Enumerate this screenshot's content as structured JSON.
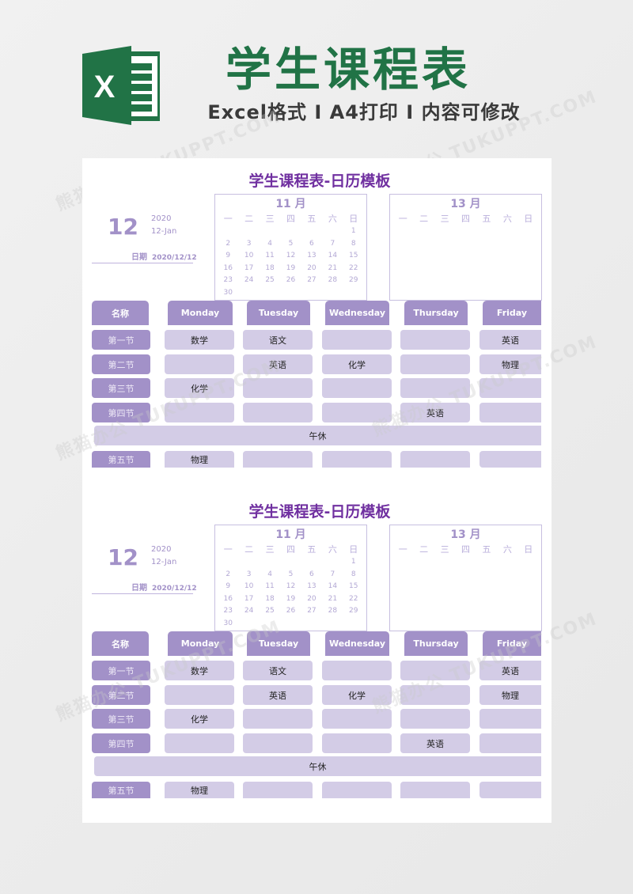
{
  "banner": {
    "logo_icon": "excel-logo-icon",
    "logo_letter": "X",
    "title": "学生课程表",
    "subtitle": "Excel格式 I A4打印 I 内容可修改",
    "watermark": "熊猫办公 TUKUPPT.COM",
    "brand_color": "#217346"
  },
  "colors": {
    "title_purple": "#7030a0",
    "header_purple": "#a291c8",
    "cell_lilac": "#d3cce6"
  },
  "sheets": [
    {
      "title": "学生课程表-日历模板",
      "date_block": {
        "day": "12",
        "year": "2020",
        "day_month": "12-Jan",
        "date_label": "日期",
        "date_value": "2020/12/12"
      },
      "calendars": [
        {
          "title": "11 月",
          "weekdays": [
            "一",
            "二",
            "三",
            "四",
            "五",
            "六",
            "日"
          ],
          "weeks": [
            [
              "",
              "",
              "",
              "",
              "",
              "",
              "1"
            ],
            [
              "2",
              "3",
              "4",
              "5",
              "6",
              "7",
              "8"
            ],
            [
              "9",
              "10",
              "11",
              "12",
              "13",
              "14",
              "15"
            ],
            [
              "16",
              "17",
              "18",
              "19",
              "20",
              "21",
              "22"
            ],
            [
              "23",
              "24",
              "25",
              "26",
              "27",
              "28",
              "29"
            ],
            [
              "30",
              "",
              "",
              "",
              "",
              "",
              ""
            ]
          ]
        },
        {
          "title": "13 月",
          "weekdays": [
            "一",
            "二",
            "三",
            "四",
            "五",
            "六",
            "日"
          ],
          "weeks": []
        }
      ],
      "schedule": {
        "corner_label": "名称",
        "days": [
          "Monday",
          "Tuesday",
          "Wednesday",
          "Thursday",
          "Friday"
        ],
        "periods": [
          {
            "label": "第一节",
            "classes": [
              "数学",
              "语文",
              "",
              "",
              "英语"
            ]
          },
          {
            "label": "第二节",
            "classes": [
              "",
              "英语",
              "化学",
              "",
              "物理"
            ]
          },
          {
            "label": "第三节",
            "classes": [
              "化学",
              "",
              "",
              "",
              ""
            ]
          },
          {
            "label": "第四节",
            "classes": [
              "",
              "",
              "",
              "英语",
              ""
            ]
          },
          {
            "label": "第五节",
            "classes": [
              "物理",
              "",
              "",
              "",
              ""
            ]
          }
        ],
        "lunch_label": "午休"
      }
    },
    {
      "title": "学生课程表-日历模板",
      "date_block": {
        "day": "12",
        "year": "2020",
        "day_month": "12-Jan",
        "date_label": "日期",
        "date_value": "2020/12/12"
      },
      "calendars": [
        {
          "title": "11 月",
          "weekdays": [
            "一",
            "二",
            "三",
            "四",
            "五",
            "六",
            "日"
          ],
          "weeks": [
            [
              "",
              "",
              "",
              "",
              "",
              "",
              "1"
            ],
            [
              "2",
              "3",
              "4",
              "5",
              "6",
              "7",
              "8"
            ],
            [
              "9",
              "10",
              "11",
              "12",
              "13",
              "14",
              "15"
            ],
            [
              "16",
              "17",
              "18",
              "19",
              "20",
              "21",
              "22"
            ],
            [
              "23",
              "24",
              "25",
              "26",
              "27",
              "28",
              "29"
            ],
            [
              "30",
              "",
              "",
              "",
              "",
              "",
              ""
            ]
          ]
        },
        {
          "title": "13 月",
          "weekdays": [
            "一",
            "二",
            "三",
            "四",
            "五",
            "六",
            "日"
          ],
          "weeks": []
        }
      ],
      "schedule": {
        "corner_label": "名称",
        "days": [
          "Monday",
          "Tuesday",
          "Wednesday",
          "Thursday",
          "Friday"
        ],
        "periods": [
          {
            "label": "第一节",
            "classes": [
              "数学",
              "语文",
              "",
              "",
              "英语"
            ]
          },
          {
            "label": "第二节",
            "classes": [
              "",
              "英语",
              "化学",
              "",
              "物理"
            ]
          },
          {
            "label": "第三节",
            "classes": [
              "化学",
              "",
              "",
              "",
              ""
            ]
          },
          {
            "label": "第四节",
            "classes": [
              "",
              "",
              "",
              "英语",
              ""
            ]
          },
          {
            "label": "第五节",
            "classes": [
              "物理",
              "",
              "",
              "",
              ""
            ]
          }
        ],
        "lunch_label": "午休"
      }
    }
  ]
}
